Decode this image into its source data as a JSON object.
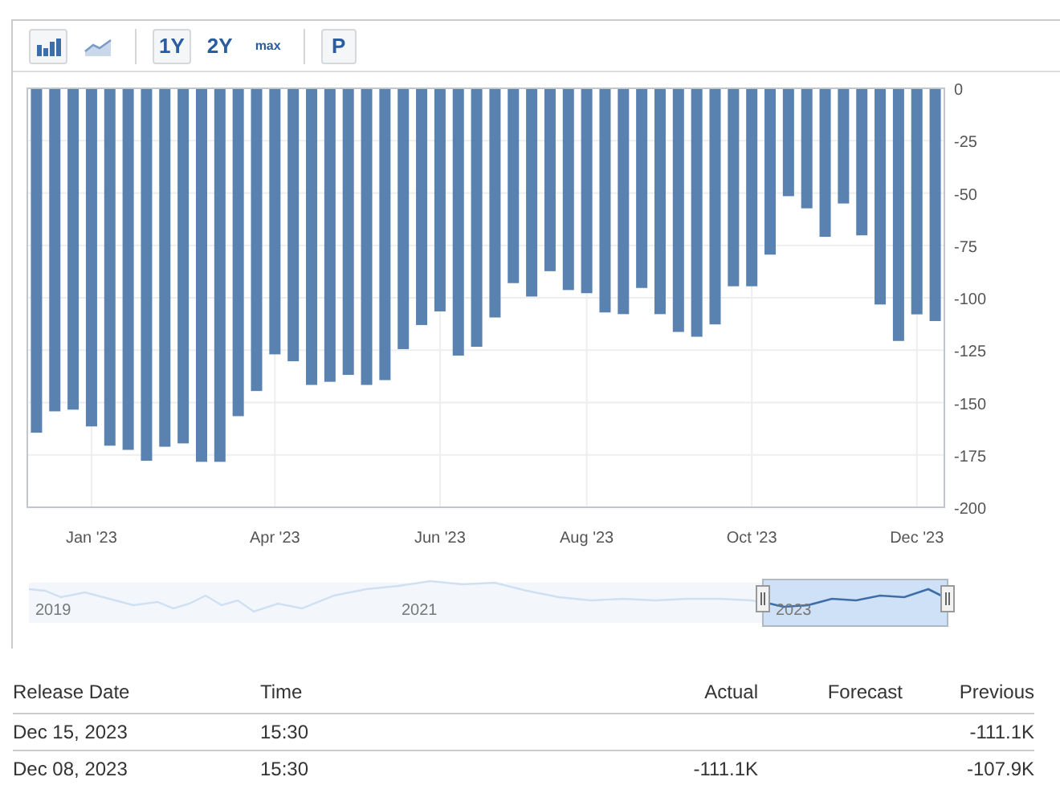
{
  "toolbar": {
    "chart_types": [
      {
        "kind": "bar",
        "selected": true
      },
      {
        "kind": "line",
        "selected": false
      }
    ],
    "ranges": [
      {
        "label": "1Y",
        "selected": true
      },
      {
        "label": "2Y",
        "selected": false
      },
      {
        "label": "max",
        "selected": false
      }
    ],
    "buttons": [
      "P"
    ]
  },
  "chart": {
    "chart_data": {
      "type": "bar",
      "grid": true,
      "categories": [
        null,
        null,
        null,
        "Jan '23",
        null,
        null,
        null,
        null,
        null,
        null,
        null,
        null,
        null,
        "Apr '23",
        null,
        null,
        null,
        null,
        null,
        null,
        null,
        null,
        "Jun '23",
        null,
        null,
        null,
        null,
        null,
        null,
        null,
        "Aug '23",
        null,
        null,
        null,
        null,
        null,
        null,
        null,
        null,
        "Oct '23",
        null,
        null,
        null,
        null,
        null,
        null,
        null,
        null,
        "Dec '23",
        null
      ],
      "series": [
        {
          "color": "#5a82b1",
          "values": [
            -164.4,
            -154.2,
            -153.4,
            -161.4,
            -170.6,
            -172.6,
            -177.8,
            -171.1,
            -169.5,
            -178.3,
            -178.3,
            -156.5,
            -144.5,
            -127,
            -130.3,
            -141.6,
            -140.1,
            -136.8,
            -141.6,
            -139.3,
            -124.5,
            -113,
            -106.5,
            -127.6,
            -123.4,
            -109.4,
            -93,
            -99.4,
            -87.3,
            -96.3,
            -97.8,
            -107,
            -107.8,
            -95.3,
            -107.8,
            -116.3,
            -118.6,
            -112.7,
            -94.5,
            -94.5,
            -79.4,
            -51.5,
            -57.3,
            -70.9,
            -55,
            -70.2,
            -103.2,
            -120.6,
            -107.9,
            -111.1
          ]
        }
      ],
      "ylim": [
        -200,
        0
      ],
      "yticks": [
        {
          "value": 0,
          "label": "0"
        },
        {
          "value": -25,
          "label": "-25"
        },
        {
          "value": -50,
          "label": "-50"
        },
        {
          "value": -75,
          "label": "-75"
        },
        {
          "value": -100,
          "label": "-100"
        },
        {
          "value": -125,
          "label": "-125"
        },
        {
          "value": -150,
          "label": "-150"
        },
        {
          "value": -175,
          "label": "-175"
        },
        {
          "value": -200,
          "label": "-200"
        }
      ]
    }
  },
  "navigator": {
    "labels": [
      "2019",
      "2021",
      "2023"
    ]
  },
  "table": {
    "columns": [
      "Release Date",
      "Time",
      "Actual",
      "Forecast",
      "Previous"
    ],
    "rows": [
      {
        "release_date": "Dec 15, 2023",
        "time": "15:30",
        "previous": "-111.1K"
      },
      {
        "release_date": "Dec 08, 2023",
        "time": "15:30",
        "actual": "-111.1K",
        "previous": "-107.9K"
      }
    ]
  }
}
